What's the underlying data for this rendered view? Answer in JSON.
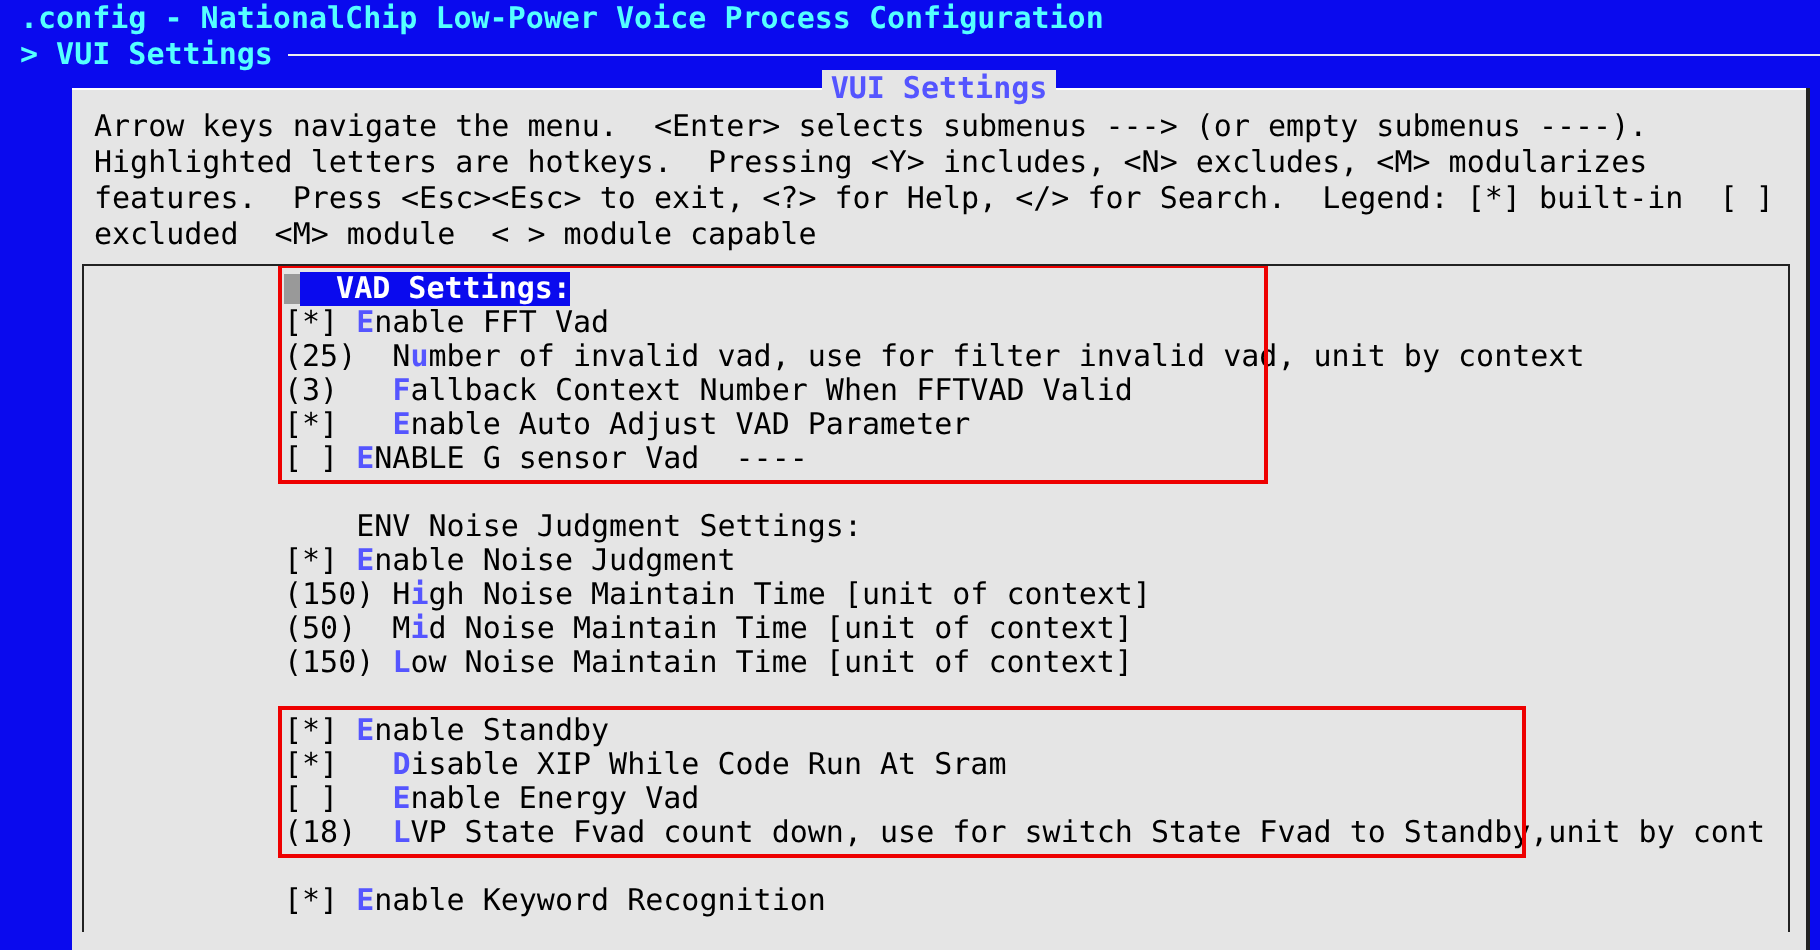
{
  "window": {
    "title": ".config - NationalChip Low-Power Voice Process Configuration",
    "breadcrumb": "> VUI Settings"
  },
  "dialog": {
    "title": "VUI Settings",
    "help": [
      "Arrow keys navigate the menu.  <Enter> selects submenus ---> (or empty submenus ----).",
      "Highlighted letters are hotkeys.  Pressing <Y> includes, <N> excludes, <M> modularizes",
      "features.  Press <Esc><Esc> to exit, <?> for Help, </> for Search.  Legend: [*] built-in  [ ]",
      "excluded  <M> module  < > module capable"
    ],
    "groups": [
      {
        "annotated": true,
        "rows": [
          {
            "text": "  VAD Settings:",
            "selected": true
          },
          {
            "text": "[*] **E**nable FFT Vad",
            "selected": false
          },
          {
            "text": "(25)  N**u**mber of invalid vad, use for filter invalid vad, unit by context",
            "selected": false
          },
          {
            "text": "(3)   **F**allback Context Number When FFTVAD Valid",
            "selected": false
          },
          {
            "text": "[*]   **E**nable Auto Adjust VAD Parameter",
            "selected": false
          },
          {
            "text": "[ ] **E**NABLE G sensor Vad  ----",
            "selected": false
          }
        ]
      },
      {
        "annotated": false,
        "rows": [
          {
            "text": "    ENV Noise Judgment Settings:",
            "selected": false
          },
          {
            "text": "[*] **E**nable Noise Judgment",
            "selected": false
          },
          {
            "text": "(150) H**i**gh Noise Maintain Time [unit of context]",
            "selected": false
          },
          {
            "text": "(50)  M**i**d Noise Maintain Time [unit of context]",
            "selected": false
          },
          {
            "text": "(150) **L**ow Noise Maintain Time [unit of context]",
            "selected": false
          }
        ]
      },
      {
        "annotated": true,
        "rows": [
          {
            "text": "[*] **E**nable Standby",
            "selected": false
          },
          {
            "text": "[*]   **D**isable XIP While Code Run At Sram",
            "selected": false
          },
          {
            "text": "[ ]   **E**nable Energy Vad",
            "selected": false
          },
          {
            "text": "(18)  **L**VP State Fvad count down, use for switch State Fvad to Standby,unit by cont",
            "selected": false
          }
        ]
      },
      {
        "annotated": false,
        "rows": [
          {
            "text": "[*] **E**nable Keyword Recognition",
            "selected": false
          }
        ]
      }
    ]
  }
}
